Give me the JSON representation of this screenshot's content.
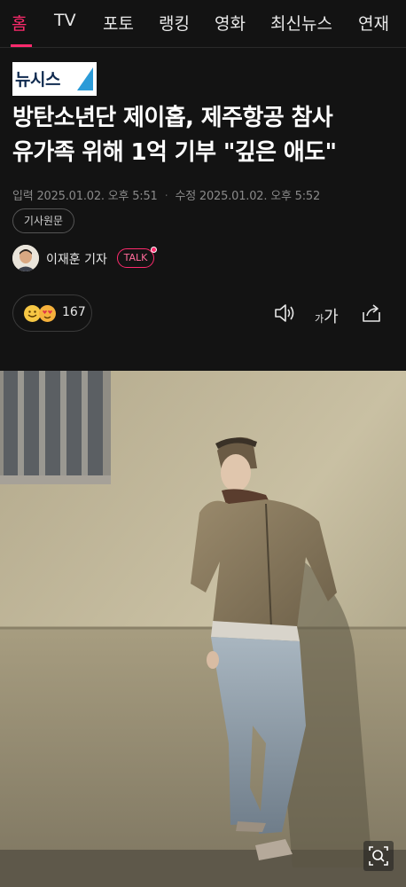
{
  "nav": {
    "items": [
      "홈",
      "TV",
      "포토",
      "랭킹",
      "영화",
      "최신뉴스",
      "연재"
    ],
    "active_index": 0,
    "accent_color": "#ff2a6d"
  },
  "publisher": {
    "logo_text": "뉴시스"
  },
  "article": {
    "headline_line1": "방탄소년단 제이홉, 제주항공 참사",
    "headline_line2": "유가족 위해 1억 기부 \"깊은 애도\"",
    "input_label": "입력",
    "input_time": "2025.01.02. 오후 5:51",
    "modified_label": "수정",
    "modified_time": "2025.01.02. 오후 5:52",
    "original_button": "기사원문",
    "author": "이재훈 기자",
    "talk_label": "TALK",
    "reaction_count": "167"
  },
  "icons": {
    "listen": "speaker-icon",
    "font_size": "font-size-icon",
    "share": "share-icon",
    "zoom": "magnifier-icon"
  }
}
